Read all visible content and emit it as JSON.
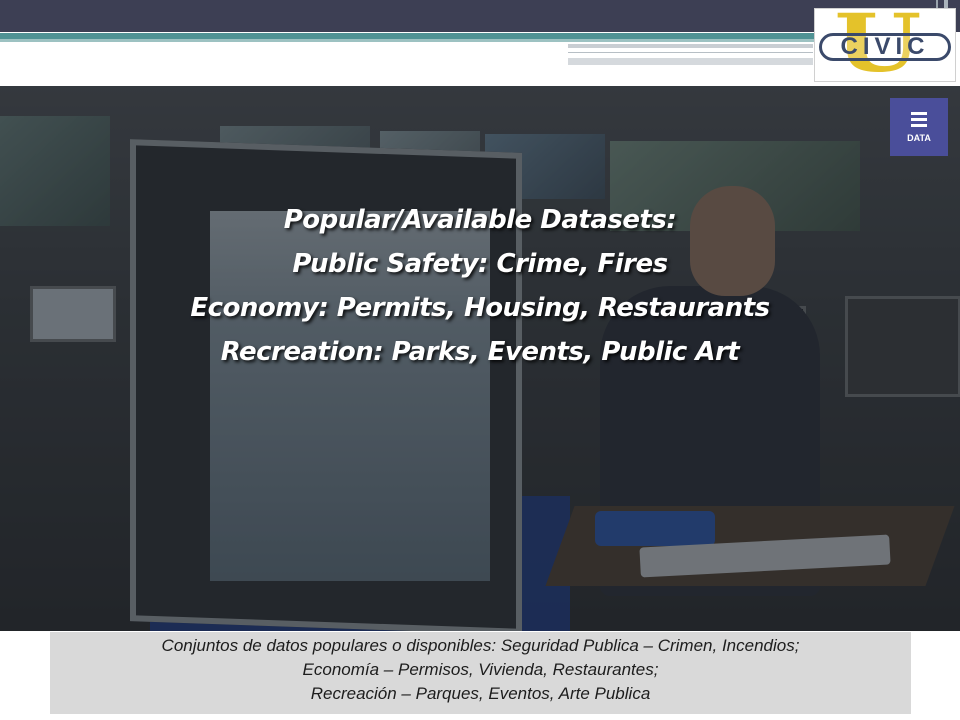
{
  "logo": {
    "letter": "U",
    "wordmark": "CIVIC"
  },
  "menu_button": {
    "label": "DATA"
  },
  "overlay": {
    "lines": [
      "Popular/Available Datasets:",
      "Public Safety: Crime, Fires",
      "Economy: Permits, Housing, Restaurants",
      "Recreation: Parks, Events, Public Art"
    ]
  },
  "caption": {
    "lines": [
      "Conjuntos de datos populares o disponibles:  Seguridad Publica – Crimen, Incendios;",
      "Economía – Permisos, Vivienda, Restaurantes;",
      "Recreación – Parques, Eventos, Arte Publica"
    ]
  },
  "colors": {
    "top_bar": "#3d3f54",
    "accent_teal": "#4f9294",
    "logo_gold": "#e4c22a",
    "logo_navy": "#3b4a6b",
    "menu_button_bg": "#4a4e9a",
    "caption_bg": "#d9d9d9"
  }
}
